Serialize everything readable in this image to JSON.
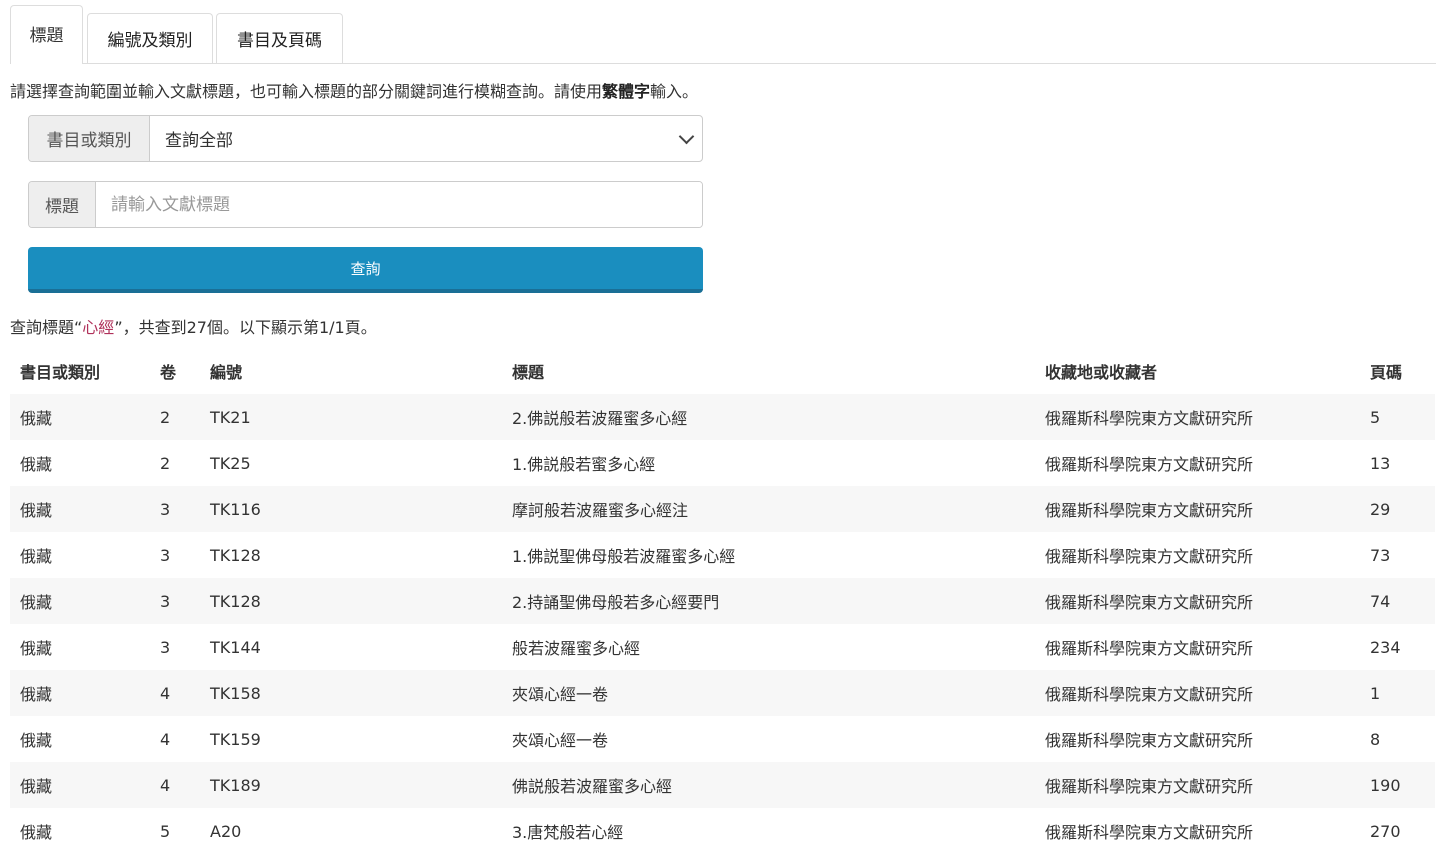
{
  "tabs": [
    {
      "label": "標題",
      "active": true
    },
    {
      "label": "編號及類別",
      "active": false
    },
    {
      "label": "書目及頁碼",
      "active": false
    }
  ],
  "instructions": {
    "prefix": "請選擇查詢範圍並輸入文獻標題，也可輸入標題的部分關鍵詞進行模糊查詢。請使用",
    "bold": "繁體字",
    "suffix": "輸入。"
  },
  "search": {
    "scope_label": "書目或類別",
    "scope_value": "查詢全部",
    "title_label": "標題",
    "title_placeholder": "請輸入文獻標題",
    "title_value": "",
    "button_label": "查詢"
  },
  "result_summary": {
    "prefix": "查詢標題“",
    "keyword": "心經",
    "suffix": "”，共查到27個。以下顯示第1/1頁。"
  },
  "table": {
    "headers": [
      "書目或類別",
      "卷",
      "編號",
      "標題",
      "收藏地或收藏者",
      "頁碼"
    ],
    "rows": [
      [
        "俄藏",
        "2",
        "TK21",
        "2.佛説般若波羅蜜多心經",
        "俄羅斯科學院東方文獻研究所",
        "5"
      ],
      [
        "俄藏",
        "2",
        "TK25",
        "1.佛説般若蜜多心經",
        "俄羅斯科學院東方文獻研究所",
        "13"
      ],
      [
        "俄藏",
        "3",
        "TK116",
        "摩訶般若波羅蜜多心經注",
        "俄羅斯科學院東方文獻研究所",
        "29"
      ],
      [
        "俄藏",
        "3",
        "TK128",
        "1.佛説聖佛母般若波羅蜜多心經",
        "俄羅斯科學院東方文獻研究所",
        "73"
      ],
      [
        "俄藏",
        "3",
        "TK128",
        "2.持誦聖佛母般若多心經要門",
        "俄羅斯科學院東方文獻研究所",
        "74"
      ],
      [
        "俄藏",
        "3",
        "TK144",
        "般若波羅蜜多心經",
        "俄羅斯科學院東方文獻研究所",
        "234"
      ],
      [
        "俄藏",
        "4",
        "TK158",
        "夾頌心經一卷",
        "俄羅斯科學院東方文獻研究所",
        "1"
      ],
      [
        "俄藏",
        "4",
        "TK159",
        "夾頌心經一卷",
        "俄羅斯科學院東方文獻研究所",
        "8"
      ],
      [
        "俄藏",
        "4",
        "TK189",
        "佛説般若波羅蜜多心經",
        "俄羅斯科學院東方文獻研究所",
        "190"
      ],
      [
        "俄藏",
        "5",
        "A20",
        "3.唐梵般若心經",
        "俄羅斯科學院東方文獻研究所",
        "270"
      ]
    ]
  },
  "colors": {
    "primary_button": "#1a8ebf",
    "keyword": "#b0305a"
  }
}
